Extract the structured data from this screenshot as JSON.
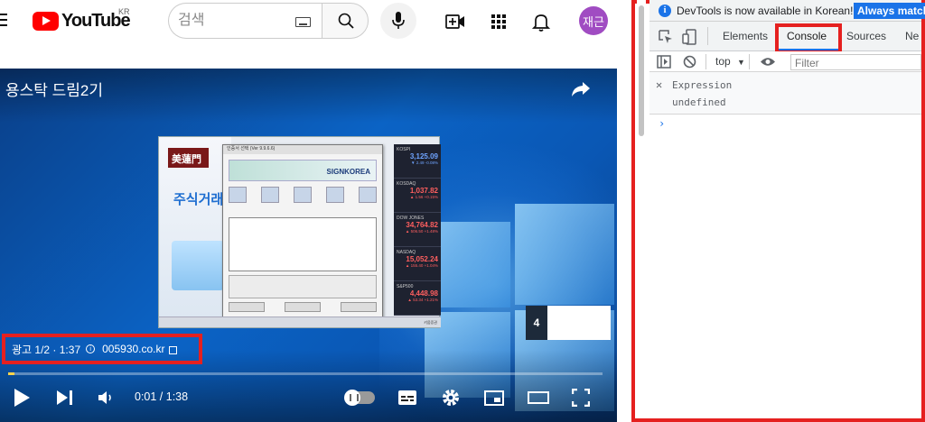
{
  "youtube": {
    "logo_text": "YouTube",
    "region": "KR",
    "search_placeholder": "검색",
    "avatar_text": "재근"
  },
  "video": {
    "title": "용스탁 드림2기",
    "ad_label": "광고 1/2 · 1:37",
    "ad_domain": "005930.co.kr",
    "skip_countdown": "4",
    "time": "0:01 / 1:38",
    "progress_fraction": 0.01
  },
  "inner_app": {
    "logo": "美蓮門",
    "headline": "주식거래",
    "dialog_title": "인증서 선택 (Ver 9.9.6.6)",
    "dialog_brand": "SIGNKOREA",
    "stocks": [
      {
        "name": "KOSPI",
        "value": "3,125.09",
        "change": "▼ 2.49 -0.08%",
        "color": "#6fa4ff"
      },
      {
        "name": "KOSDAQ",
        "value": "1,037.82",
        "change": "▲ 1.56 +0.15%",
        "color": "#ff5f5f"
      },
      {
        "name": "DOW JONES",
        "value": "34,764.82",
        "change": "▲ 506.50 +1.48%",
        "color": "#ff5f5f"
      },
      {
        "name": "NASDAQ",
        "value": "15,052.24",
        "change": "▲ 155.40 +1.04%",
        "color": "#ff5f5f"
      },
      {
        "name": "S&P500",
        "value": "4,448.98",
        "change": "▲ 53.34 +1.21%",
        "color": "#ff5f5f"
      }
    ],
    "status": "키움증권"
  },
  "devtools": {
    "banner": "DevTools is now available in Korean!",
    "banner_button": "Always match",
    "tabs": [
      "Elements",
      "Console",
      "Sources",
      "Ne"
    ],
    "context": "top",
    "filter_placeholder": "Filter",
    "expression_label": "Expression",
    "expression_value": "undefined",
    "prompt": "›"
  },
  "colors": {
    "youtube_red": "#ff0000",
    "highlight_red": "#e5201f",
    "devtools_blue": "#1a73e8",
    "avatar": "#a04cc2"
  }
}
